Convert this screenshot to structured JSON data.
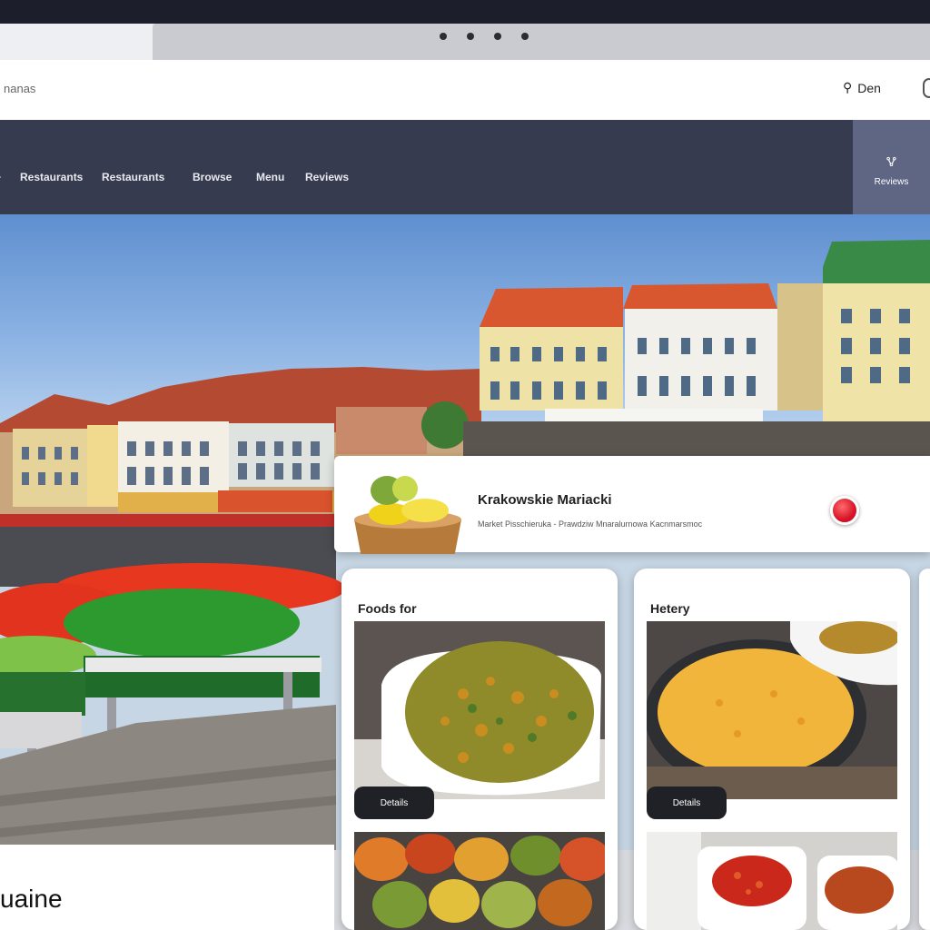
{
  "topbar": {
    "brand": "nanas",
    "user_icon": "person-icon",
    "user_label": "Den"
  },
  "nav": {
    "items": [
      "·",
      "Restaurants",
      "Restaurants",
      "Browse",
      "Menu",
      "Reviews"
    ],
    "cta_icon": "basket-icon",
    "cta_label": "Reviews"
  },
  "feature": {
    "title": "Krakowskie Mariacki",
    "subtitle": "Market Pisschieruka - Prawdziw Mnaralurnowa Kacnmarsmoc"
  },
  "cards": [
    {
      "title": "Foods for",
      "pill": "Details"
    },
    {
      "title": "Hetery",
      "pill": "Details"
    }
  ],
  "cuisine": {
    "label": "uaine"
  }
}
